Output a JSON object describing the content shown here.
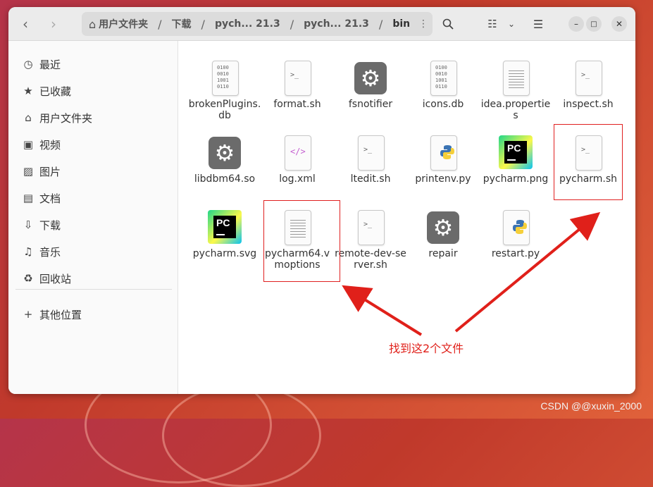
{
  "path": {
    "crumbs": [
      "用户文件夹",
      "下载",
      "pych... 21.3",
      "pych... 21.3",
      "bin"
    ],
    "separator": "/"
  },
  "sidebar": {
    "items": [
      {
        "label": "最近",
        "icon": "clock-icon",
        "glyph": "◷"
      },
      {
        "label": "已收藏",
        "icon": "star-icon",
        "glyph": "★"
      },
      {
        "label": "用户文件夹",
        "icon": "home-icon",
        "glyph": "⌂"
      },
      {
        "label": "视频",
        "icon": "film-icon",
        "glyph": "▣"
      },
      {
        "label": "图片",
        "icon": "image-icon",
        "glyph": "▨"
      },
      {
        "label": "文档",
        "icon": "document-icon",
        "glyph": "▤"
      },
      {
        "label": "下载",
        "icon": "download-icon",
        "glyph": "⇩"
      },
      {
        "label": "音乐",
        "icon": "music-icon",
        "glyph": "♫"
      },
      {
        "label": "回收站",
        "icon": "trash-icon",
        "glyph": "♻"
      }
    ],
    "other": {
      "label": "其他位置",
      "icon": "plus-icon",
      "glyph": "+"
    }
  },
  "files": [
    {
      "name": "brokenPlugins.db",
      "type": "binary"
    },
    {
      "name": "format.sh",
      "type": "script"
    },
    {
      "name": "fsnotifier",
      "type": "executable"
    },
    {
      "name": "icons.db",
      "type": "binary"
    },
    {
      "name": "idea.properties",
      "type": "text"
    },
    {
      "name": "inspect.sh",
      "type": "script"
    },
    {
      "name": "libdbm64.so",
      "type": "executable"
    },
    {
      "name": "log.xml",
      "type": "xml"
    },
    {
      "name": "ltedit.sh",
      "type": "script"
    },
    {
      "name": "printenv.py",
      "type": "python"
    },
    {
      "name": "pycharm.png",
      "type": "pycharm"
    },
    {
      "name": "pycharm.sh",
      "type": "script"
    },
    {
      "name": "pycharm.svg",
      "type": "pycharm"
    },
    {
      "name": "pycharm64.vmoptions",
      "type": "text"
    },
    {
      "name": "remote-dev-server.sh",
      "type": "script"
    },
    {
      "name": "repair",
      "type": "executable"
    },
    {
      "name": "restart.py",
      "type": "python"
    }
  ],
  "icon_glyphs": {
    "script": ">_",
    "binary": "0100\n0010\n1001\n0110",
    "xml": "</>",
    "gear": "⚙"
  },
  "annotation": {
    "text": "找到这2个文件",
    "color": "#e0201a",
    "highlighted": [
      "pycharm.sh",
      "pycharm64.vmoptions"
    ]
  },
  "watermark": "CSDN @@xuxin_2000"
}
